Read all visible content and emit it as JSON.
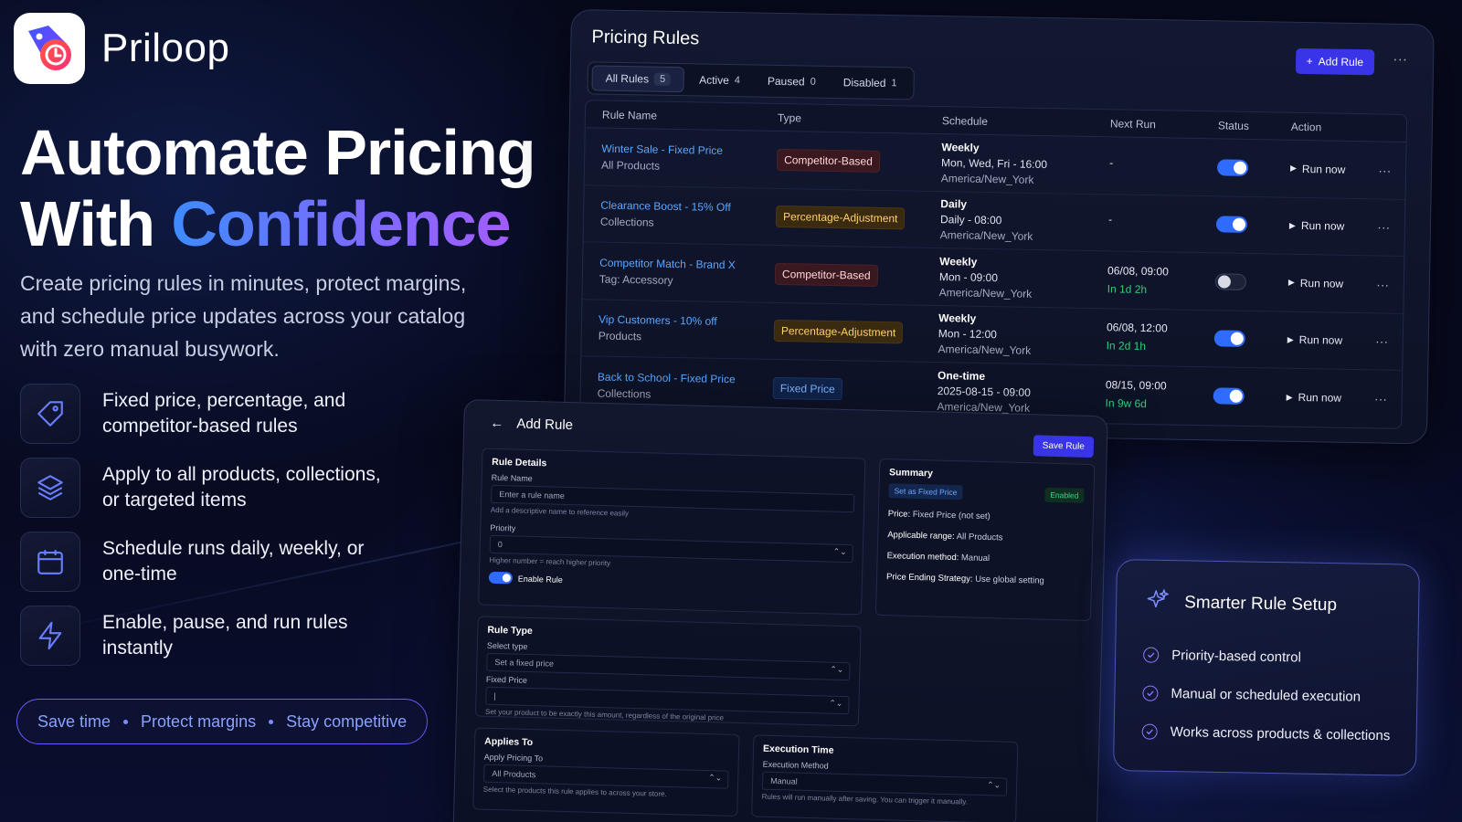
{
  "brand": {
    "name": "Priloop"
  },
  "hero": {
    "headline_line1": "Automate Pricing",
    "headline_line2_plain": "With ",
    "headline_line2_accent": "Confidence",
    "subtext": "Create pricing rules in minutes, protect margins, and schedule price updates across your catalog with zero manual busywork."
  },
  "features": [
    {
      "icon": "tag-icon",
      "text": "Fixed price, percentage, and competitor-based rules"
    },
    {
      "icon": "layers-icon",
      "text": "Apply to all products, collections, or targeted items"
    },
    {
      "icon": "calendar-icon",
      "text": "Schedule runs daily, weekly, or one-time"
    },
    {
      "icon": "lightning-icon",
      "text": "Enable, pause, and run rules instantly"
    }
  ],
  "pill": {
    "items": [
      "Save time",
      "Protect margins",
      "Stay competitive"
    ]
  },
  "rules": {
    "title": "Pricing Rules",
    "add_label": "Add Rule",
    "more_label": "···",
    "tabs": [
      {
        "label": "All Rules",
        "count": "5"
      },
      {
        "label": "Active",
        "count": "4"
      },
      {
        "label": "Paused",
        "count": "0"
      },
      {
        "label": "Disabled",
        "count": "1"
      }
    ],
    "columns": [
      "Rule Name",
      "Type",
      "Schedule",
      "Next Run",
      "Status",
      "Action"
    ],
    "run_label": "Run now",
    "rows": [
      {
        "name": "Winter Sale - Fixed Price",
        "scope": "All Products",
        "type": "Competitor-Based",
        "type_style": "comp",
        "freq": "Weekly",
        "when": "Mon, Wed, Fri - 16:00",
        "tz": "America/New_York",
        "next": "-",
        "next_in": "",
        "enabled": true
      },
      {
        "name": "Clearance Boost - 15% Off",
        "scope": "Collections",
        "type": "Percentage-Adjustment",
        "type_style": "pct",
        "freq": "Daily",
        "when": "Daily - 08:00",
        "tz": "America/New_York",
        "next": "-",
        "next_in": "",
        "enabled": true
      },
      {
        "name": "Competitor Match - Brand X",
        "scope": "Tag: Accessory",
        "type": "Competitor-Based",
        "type_style": "comp",
        "freq": "Weekly",
        "when": "Mon - 09:00",
        "tz": "America/New_York",
        "next": "06/08, 09:00",
        "next_in": "In 1d 2h",
        "enabled": false
      },
      {
        "name": "Vip Customers - 10% off",
        "scope": "Products",
        "type": "Percentage-Adjustment",
        "type_style": "pct",
        "freq": "Weekly",
        "when": "Mon - 12:00",
        "tz": "America/New_York",
        "next": "06/08, 12:00",
        "next_in": "In 2d 1h",
        "enabled": true
      },
      {
        "name": "Back to School - Fixed Price",
        "scope": "Collections",
        "type": "Fixed Price",
        "type_style": "fix",
        "freq": "One-time",
        "when": "2025-08-15 - 09:00",
        "tz": "America/New_York",
        "next": "08/15, 09:00",
        "next_in": "In 9w 6d",
        "enabled": true
      }
    ]
  },
  "add_rule": {
    "title": "Add Rule",
    "save_label": "Save Rule",
    "details": {
      "title": "Rule Details",
      "name_label": "Rule Name",
      "name_placeholder": "Enter a rule name",
      "name_hint": "Add a descriptive name to reference easily",
      "priority_label": "Priority",
      "priority_value": "0",
      "priority_hint": "Higher number = reach higher priority",
      "enable_label": "Enable Rule"
    },
    "summary": {
      "title": "Summary",
      "tag": "Set as Fixed Price",
      "status": "Enabled",
      "price_label": "Price:",
      "price_value": "Fixed Price (not set)",
      "range_label": "Applicable range:",
      "range_value": "All Products",
      "exec_label": "Execution method:",
      "exec_value": "Manual",
      "ending_label": "Price Ending Strategy:",
      "ending_value": "Use global setting"
    },
    "rule_type": {
      "title": "Rule Type",
      "select_label": "Select type",
      "select_value": "Set a fixed price",
      "fixed_label": "Fixed Price",
      "fixed_value": "|",
      "fixed_hint": "Set your product to be exactly this amount, regardless of the original price"
    },
    "applies": {
      "title": "Applies To",
      "label": "Apply Pricing To",
      "value": "All Products",
      "hint": "Select the products this rule applies to across your store."
    },
    "execution": {
      "title": "Execution Time",
      "label": "Execution Method",
      "value": "Manual",
      "hint": "Rules will run manually after saving. You can trigger it manually."
    }
  },
  "smart": {
    "title": "Smarter Rule Setup",
    "items": [
      "Priority-based control",
      "Manual or scheduled execution",
      "Works across products & collections"
    ]
  }
}
